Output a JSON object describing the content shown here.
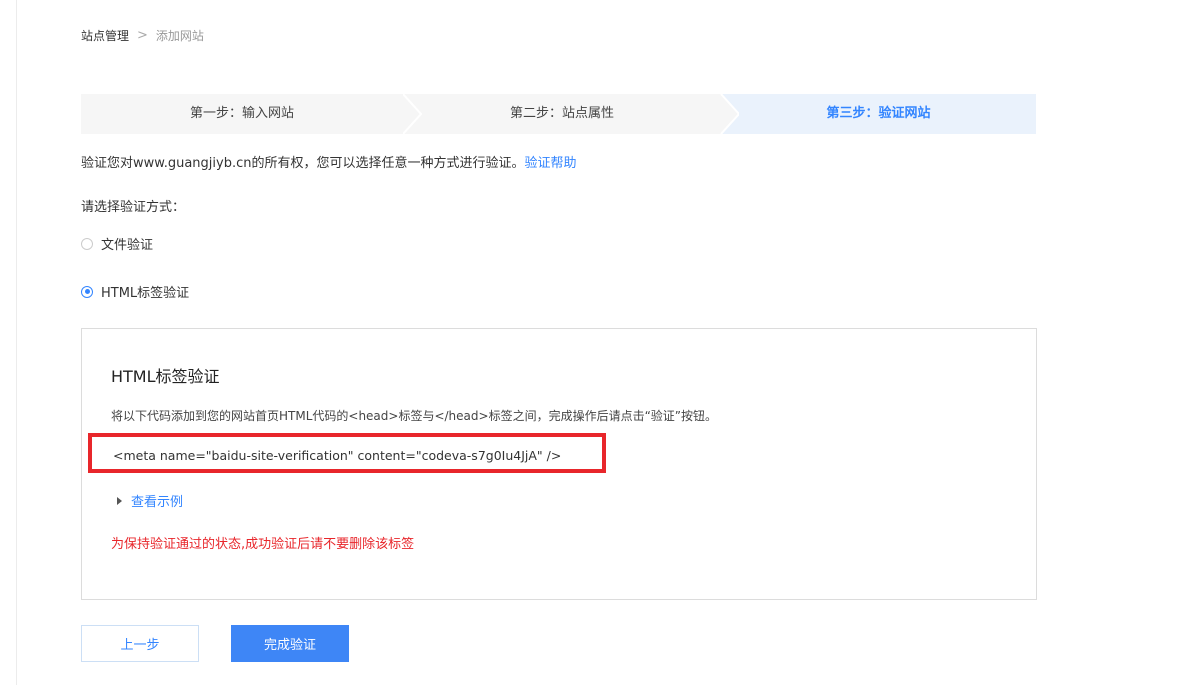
{
  "breadcrumb": {
    "root": "站点管理",
    "separator": ">",
    "current": "添加网站"
  },
  "steps": [
    {
      "label": "第一步：输入网站",
      "active": false
    },
    {
      "label": "第二步：站点属性",
      "active": false
    },
    {
      "label": "第三步：验证网站",
      "active": true
    }
  ],
  "description": {
    "text": "验证您对www.guangjiyb.cn的所有权，您可以选择任意一种方式进行验证。",
    "help_link": "验证帮助"
  },
  "method_label": "请选择验证方式：",
  "methods": {
    "file": {
      "label": "文件验证",
      "checked": false
    },
    "html": {
      "label": "HTML标签验证",
      "checked": true
    }
  },
  "panel": {
    "title": "HTML标签验证",
    "description": "将以下代码添加到您的网站首页HTML代码的<head>标签与</head>标签之间，完成操作后请点击“验证”按钮。",
    "code": "<meta name=\"baidu-site-verification\" content=\"codeva-s7g0Iu4JjA\" />",
    "example_link": "查看示例",
    "warning": "为保持验证通过的状态,成功验证后请不要删除该标签"
  },
  "buttons": {
    "prev": "上一步",
    "done": "完成验证"
  },
  "colors": {
    "accent": "#3385ff",
    "warning": "#e8262b",
    "primary_button": "#3e86f6"
  }
}
